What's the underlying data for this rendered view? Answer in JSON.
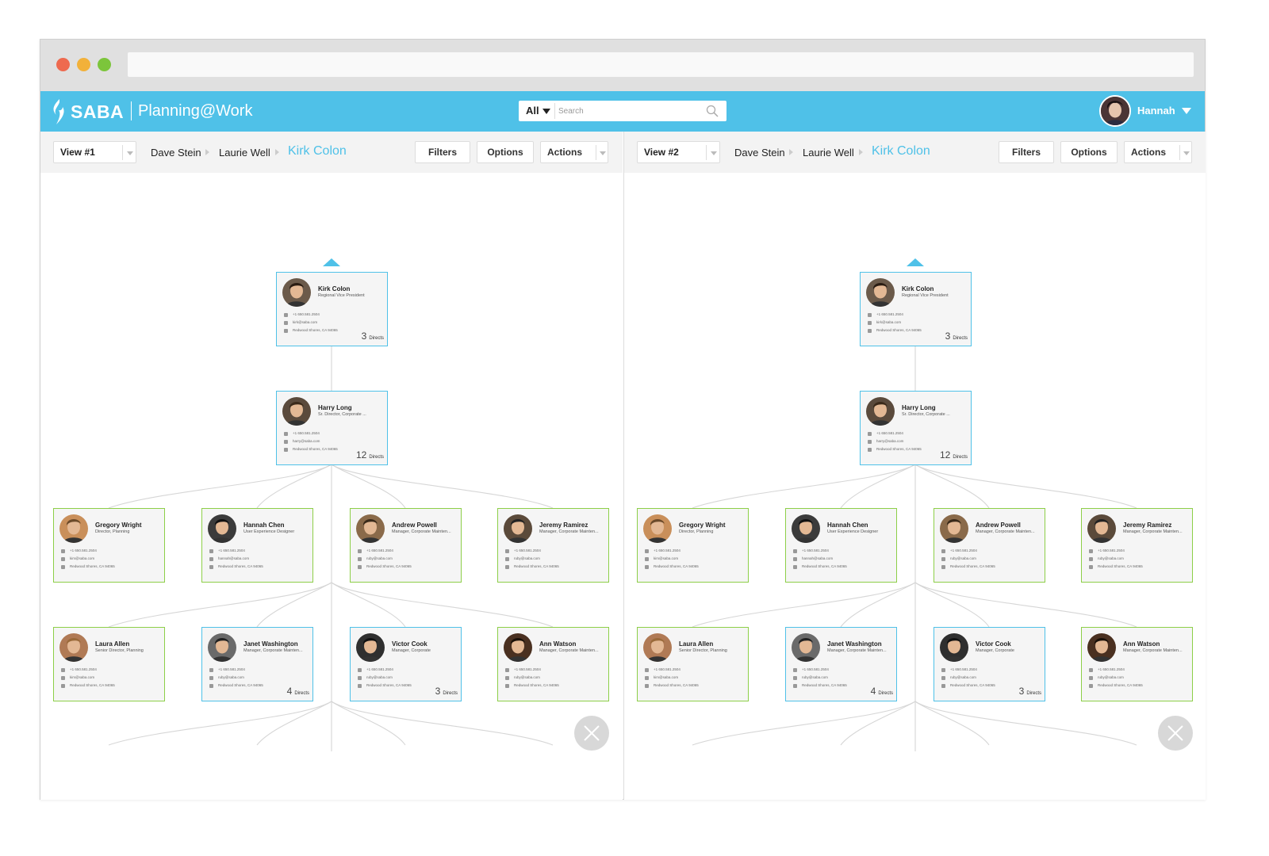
{
  "app": {
    "brand": "SABA",
    "product": "Planning@Work",
    "search": {
      "scope": "All",
      "placeholder": "Search"
    },
    "user": {
      "name": "Hannah"
    },
    "colors": {
      "accent": "#4fc1e8",
      "manager_border": "#4fc1e8",
      "leaf_border": "#8dcf48"
    }
  },
  "panes": [
    {
      "view": "View #1",
      "breadcrumb": [
        "Dave Stein",
        "Laurie Well"
      ],
      "current": "Kirk Colon",
      "buttons": {
        "filters": "Filters",
        "options": "Options",
        "actions": "Actions"
      }
    },
    {
      "view": "View #2",
      "breadcrumb": [
        "Dave Stein",
        "Laurie Well"
      ],
      "current": "Kirk Colon",
      "buttons": {
        "filters": "Filters",
        "options": "Options",
        "actions": "Actions"
      }
    }
  ],
  "org": {
    "directs_label": "Directs",
    "root": {
      "name": "Kirk Colon",
      "title": "Regional Vice President",
      "phone": "+1 650.581.2504",
      "email": "kirk@saba.com",
      "location": "Redwood Shores, CA 94065",
      "directs": "3"
    },
    "manager": {
      "name": "Harry Long",
      "title": "Sr. Director, Corporate ...",
      "phone": "+1 650.581.2504",
      "email": "harry@saba.com",
      "location": "Redwood Shores, CA 94065",
      "directs": "12"
    },
    "row1": [
      {
        "name": "Gregory Wright",
        "title": "Director, Planning",
        "phone": "+1 650.581.2504",
        "email": "kim@saba.com",
        "location": "Redwood Shores, CA 94065",
        "directs": ""
      },
      {
        "name": "Hannah Chen",
        "title": "User Experience Designer",
        "phone": "+1 650.581.2504",
        "email": "hannah@saba.com",
        "location": "Redwood Shores, CA 94065",
        "directs": ""
      },
      {
        "name": "Andrew Powell",
        "title": "Manager, Corporate Mainten...",
        "phone": "+1 650.581.2504",
        "email": "ruby@saba.com",
        "location": "Redwood Shores, CA 94065",
        "directs": ""
      },
      {
        "name": "Jeremy Ramirez",
        "title": "Manager, Corporate Mainten...",
        "phone": "+1 650.581.2504",
        "email": "ruby@saba.com",
        "location": "Redwood Shores, CA 94065",
        "directs": ""
      }
    ],
    "row2": [
      {
        "name": "Laura Allen",
        "title": "Senior Director, Planning",
        "phone": "+1 650.581.2504",
        "email": "kim@saba.com",
        "location": "Redwood Shores, CA 94065",
        "directs": ""
      },
      {
        "name": "Janet Washington",
        "title": "Manager, Corporate Mainten...",
        "phone": "+1 650.581.2504",
        "email": "ruby@saba.com",
        "location": "Redwood Shores, CA 94065",
        "directs": "4"
      },
      {
        "name": "Victor Cook",
        "title": "Manager, Corporate",
        "phone": "+1 650.581.2504",
        "email": "ruby@saba.com",
        "location": "Redwood Shores, CA 94065",
        "directs": "3"
      },
      {
        "name": "Ann Watson",
        "title": "Manager, Corporate Mainten...",
        "phone": "+1 650.581.2504",
        "email": "ruby@saba.com",
        "location": "Redwood Shores, CA 94065",
        "directs": ""
      }
    ]
  }
}
